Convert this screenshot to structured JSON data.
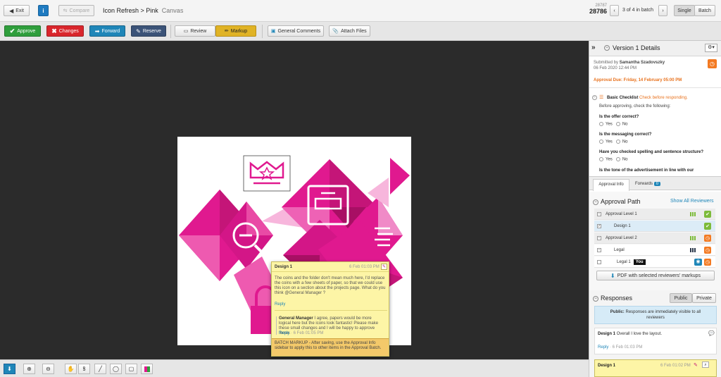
{
  "header": {
    "exit_label": "Exit",
    "compare_label": "Compare",
    "title": "Icon Refresh > Pink",
    "subtitle": "Canvas",
    "version_prev": "28787",
    "version_current": "28786",
    "batch_position": "3 of 4 in batch",
    "single_label": "Single",
    "batch_label": "Batch"
  },
  "toolbar": {
    "approve": "Approve",
    "changes": "Changes",
    "forward": "Forward",
    "reserve": "Reserve",
    "review": "Review",
    "markup": "Markup",
    "general_comments": "General Comments",
    "attach_files": "Attach Files"
  },
  "note": {
    "author": "Design 1",
    "date": "6 Feb 01:03 PM",
    "text": "The coins and the folder don't mean much here, I'd replace the coins with a few sheets of paper, so that we could use this icon on a section about the projects page. What do you think @General Manager ?",
    "reply": "Reply",
    "reply_author": "General Manager",
    "reply_text": "I agree, papers would be more logical here but the icons look fantastic! Please make these small changes and I will be happy to approve these.",
    "reply_link": "Reply",
    "reply_date": "· 6 Feb 01:05 PM",
    "batch_text": "BATCH MARKUP - After saving, use the Approval Info sidebar to apply this to other items in the Approval Batch."
  },
  "sidebar": {
    "heading": "Version 1 Details",
    "submitted_label": "Submitted by",
    "submitter": "Samantha Szadovszky",
    "submitted_date": "06 Feb 2020 12:44 PM",
    "due": "Approval Due: Friday, 14 February 05:00 PM",
    "checklist_title": "Basic Checklist",
    "checklist_hint": "Check before responding.",
    "checklist_intro": "Before approving, check the following:",
    "questions": [
      "Is the offer correct?",
      "Is the messaging correct?",
      "Have you checked spelling and sentence structure?",
      "Is the tone of the advertisement in line with our"
    ],
    "yes": "Yes",
    "no": "No",
    "tab_approval": "Approval Info",
    "tab_forwards": "Forwards",
    "forwards_count": "0",
    "approval_path": "Approval Path",
    "show_all": "Show All Reviewers",
    "levels": [
      "Approval Level 1",
      "Design 1",
      "Approval Level 2",
      "Legal",
      "Legal 1"
    ],
    "you_badge": "You",
    "pdf_button": "PDF with selected reviewers' markups",
    "responses": "Responses",
    "public": "Public",
    "private": "Private",
    "public_note_bold": "Public:",
    "public_note": "Responses are immediately visible to all reviewers",
    "response_author": "Design 1",
    "response_text": "Overall I love the layout.",
    "response_reply": "Reply",
    "response_date": "· 6 Feb 01:03 PM",
    "bottom_author": "Design 1",
    "bottom_date": "6 Feb 01:02 PM"
  },
  "colors": {
    "approve": "#2f9e3c",
    "changes": "#d9262c",
    "forward": "#1f86b8",
    "reserve": "#3b5378",
    "markup": "#e0b325",
    "magenta": "#e0198f",
    "orange_due": "#e8711c"
  }
}
